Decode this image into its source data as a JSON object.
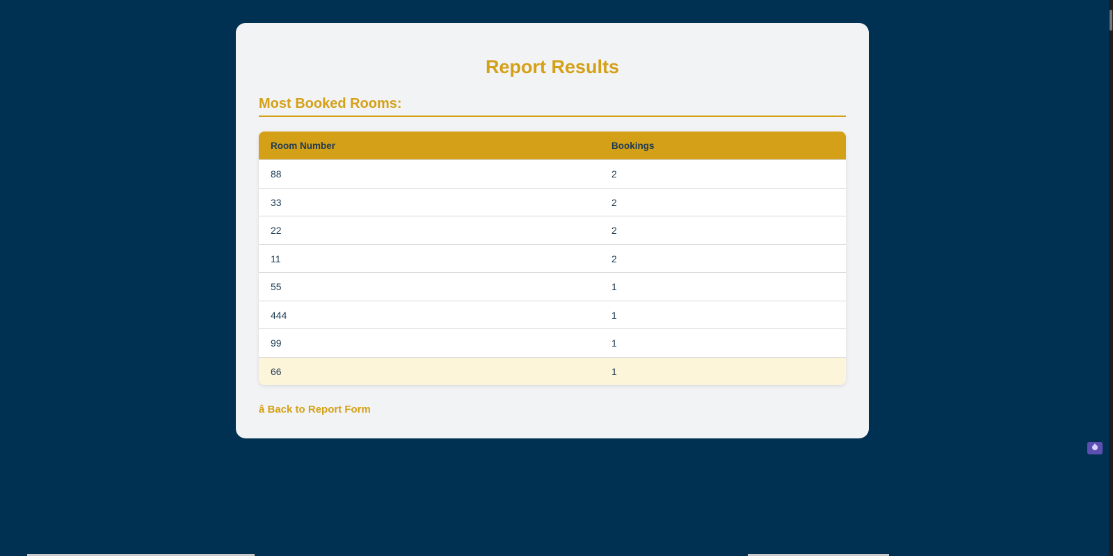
{
  "colors": {
    "background": "#003153",
    "card": "#f2f3f5",
    "accent": "#d4a017",
    "header_text": "#1d3a52",
    "highlight_row": "#fdf5d9"
  },
  "report": {
    "title": "Report Results",
    "section_heading": "Most Booked Rooms:",
    "columns": [
      "Room Number",
      "Bookings"
    ],
    "rows": [
      {
        "room": "88",
        "bookings": "2"
      },
      {
        "room": "33",
        "bookings": "2"
      },
      {
        "room": "22",
        "bookings": "2"
      },
      {
        "room": "11",
        "bookings": "2"
      },
      {
        "room": "55",
        "bookings": "1"
      },
      {
        "room": "444",
        "bookings": "1"
      },
      {
        "room": "99",
        "bookings": "1"
      },
      {
        "room": "66",
        "bookings": "1"
      }
    ],
    "back_link": "â Back to Report Form"
  },
  "extension_badge": {
    "icon": "hand-icon"
  }
}
